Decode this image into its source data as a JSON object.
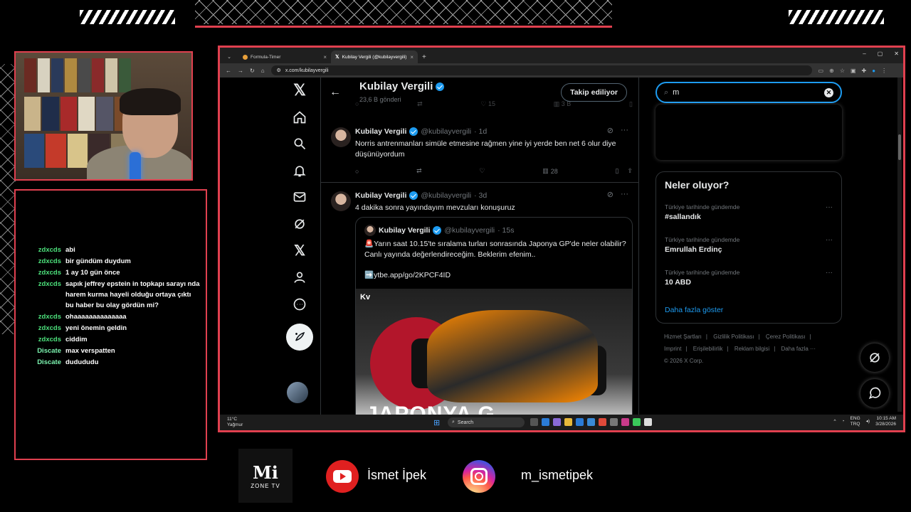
{
  "chat": {
    "messages": [
      {
        "user": "zdxcds",
        "text": "abi",
        "color": "#4ce07b"
      },
      {
        "user": "zdxcds",
        "text": "bir gündüm duydum",
        "color": "#4ce07b"
      },
      {
        "user": "zdxcds",
        "text": "1 ay 10 gün önce",
        "color": "#4ce07b"
      },
      {
        "user": "zdxcds",
        "text": "sapık jeffrey epstein in topkapı sarayı nda harem kurma hayeli olduğu ortaya çıktı bu haber bu olay gördün mi?",
        "color": "#4ce07b"
      },
      {
        "user": "zdxcds",
        "text": "ohaaaaaaaaaaaaaa",
        "color": "#4ce07b"
      },
      {
        "user": "zdxcds",
        "text": "yeni önemin geldin",
        "color": "#4ce07b"
      },
      {
        "user": "zdxcds",
        "text": "ciddim",
        "color": "#4ce07b"
      },
      {
        "user": "Discate",
        "text": "max verspatten",
        "color": "#7cf5b0"
      },
      {
        "user": "Discate",
        "text": "dudududu",
        "color": "#7cf5b0"
      }
    ]
  },
  "browser": {
    "tabs": [
      {
        "title": "Formula-Timer"
      },
      {
        "title": "Kubilay Vergili (@kubilayvergili)"
      }
    ],
    "new_tab": "+",
    "window_controls": [
      "–",
      "▢",
      "✕"
    ],
    "url": "x.com/kubilayvergili"
  },
  "profile": {
    "name": "Kubilay Vergili",
    "posts_count": "23,6 B gönderi",
    "follow_label": "Takip ediliyor",
    "top_stats": {
      "views": "3 B",
      "likes": "15"
    }
  },
  "tweets": [
    {
      "name": "Kubilay Vergili",
      "handle": "@kubilayvergili",
      "time": "· 1d",
      "text": "Norris antrenmanları simüle etmesine rağmen yine iyi yerde ben net 6 olur diye düşünüyordum",
      "views": "28"
    },
    {
      "name": "Kubilay Vergili",
      "handle": "@kubilayvergili",
      "time": "· 3d",
      "text": "4 dakika sonra yayındayım mevzuları konuşuruz",
      "quote": {
        "name": "Kubilay Vergili",
        "handle": "@kubilayvergili",
        "time": "· 15s",
        "text": "🚨Yarın saat 10.15'te sıralama turları sonrasında Japonya GP'de neler olabilir? Canlı yayında değerlendireceğim. Beklerim efenim..",
        "link": "➡️ytbe.app/go/2KPCF4ID",
        "media_logo": "Kv",
        "media_caption": "JAPONYA G"
      }
    }
  ],
  "search": {
    "value": "m",
    "clear": "✕"
  },
  "trends": {
    "title": "Neler oluyor?",
    "items": [
      {
        "context": "Türkiye tarihinde gündemde",
        "name": "#sallandık"
      },
      {
        "context": "Türkiye tarihinde gündemde",
        "name": "Emrullah Erdinç"
      },
      {
        "context": "Türkiye tarihinde gündemde",
        "name": "10 ABD"
      }
    ],
    "more_icon": "···",
    "show_more": "Daha fazla göster"
  },
  "footer": {
    "links": [
      "Hizmet Şartları",
      "|",
      "Gizlilik Politikası",
      "|",
      "Çerez Politikası",
      "|",
      "Imprint",
      "|",
      "Erişilebilirlik",
      "|",
      "Reklam bilgisi",
      "|",
      "Daha fazla ···"
    ],
    "copyright": "© 2026 X Corp."
  },
  "taskbar": {
    "weather_temp": "11°C",
    "weather_desc": "Yağmur",
    "search_label": "Search",
    "lang_top": "ENG",
    "lang_bottom": "TRQ",
    "time": "10:15 AM",
    "date": "3/28/2026"
  },
  "branding": {
    "logo_main": "Mi",
    "logo_sub": "ZONE TV",
    "youtube_name": "İsmet İpek",
    "instagram_handle": "m_ismetipek"
  },
  "colors": {
    "accent": "#e0404f",
    "x_blue": "#1d9bf0"
  }
}
